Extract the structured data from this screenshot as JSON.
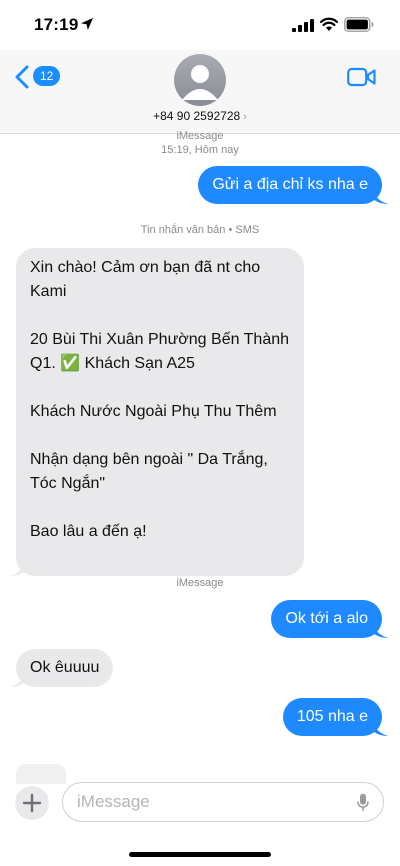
{
  "status_bar": {
    "time": "17:19"
  },
  "header": {
    "back_badge": "12",
    "contact_number": "+84 90 2592728",
    "contact_chevron": "›"
  },
  "thread": {
    "meta_imessage_top": "iMessage",
    "meta_timestamp": "15:19, Hôm nay",
    "msg_1": "Gửi a địa chỉ ks nha e",
    "meta_sms": "Tin nhắn văn bản • SMS",
    "msg_2_paragraphs": [
      "Xin chào! Cảm ơn bạn đã nt cho Kami",
      "20 Bùi Thi Xuân Phường Bến Thành Q1. ✅ Khách Sạn A25",
      "Khách Nước Ngoài Phụ Thu Thêm",
      "Nhận dạng bên ngoài \" Da Trắng, Tóc Ngắn\"",
      "Bao lâu a đến ạ!"
    ],
    "meta_imessage_2": "iMessage",
    "msg_3": "Ok tới a alo",
    "msg_4": "Ok êuuuu",
    "msg_5": "105 nha e"
  },
  "compose": {
    "placeholder": "iMessage"
  },
  "colors": {
    "accent": "#1f8aff",
    "incoming": "#e9e9eb",
    "meta": "#8a8a8e"
  },
  "icons": [
    "location-arrow-icon",
    "signal-icon",
    "wifi-icon",
    "battery-icon",
    "back-chevron-icon",
    "avatar-icon",
    "video-call-icon",
    "plus-icon",
    "mic-icon"
  ]
}
